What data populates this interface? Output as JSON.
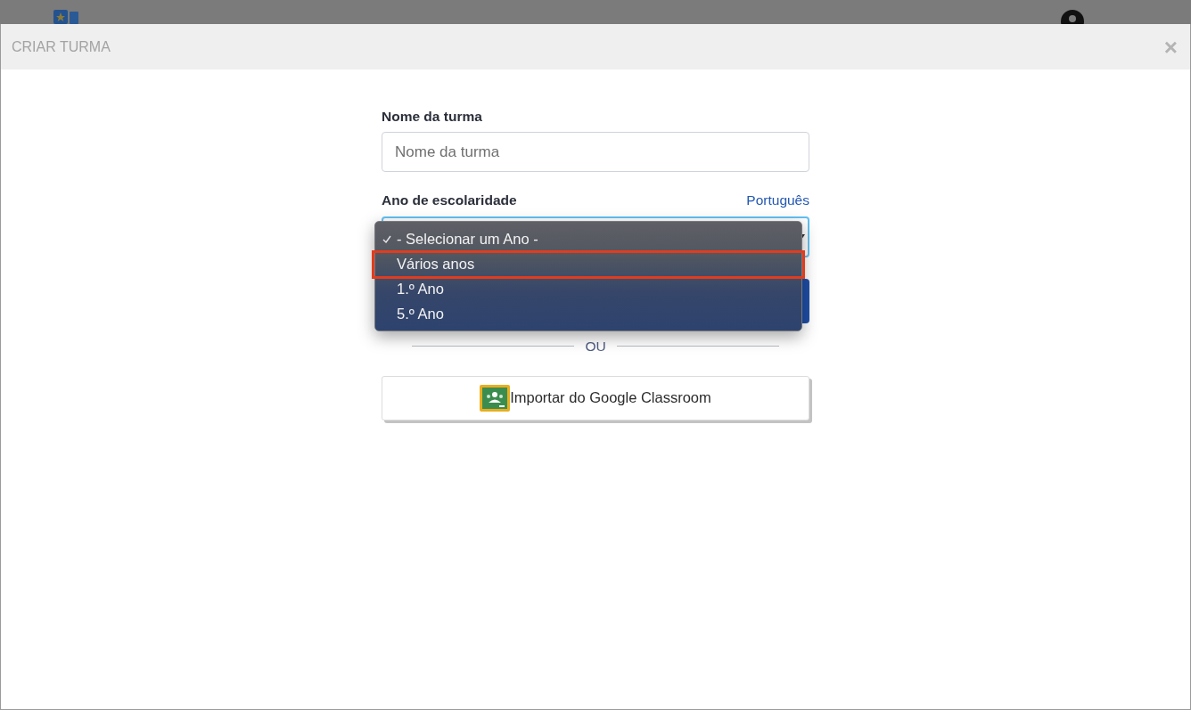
{
  "modal": {
    "title": "CRIAR TURMA",
    "close": "×"
  },
  "form": {
    "name_field": {
      "label": "Nome da turma",
      "placeholder": "Nome da turma"
    },
    "grade_field": {
      "label": "Ano de escolaridade",
      "language_link": "Português",
      "focused": true,
      "expanded": true
    },
    "grade_options": [
      {
        "label": "- Selecionar um Ano -",
        "selected": true,
        "highlighted": false
      },
      {
        "label": "Vários anos",
        "selected": false,
        "highlighted": true
      },
      {
        "label": "1.º Ano",
        "selected": false,
        "highlighted": false
      },
      {
        "label": "5.º Ano",
        "selected": false,
        "highlighted": false
      }
    ],
    "divider": "OU",
    "import_button": "Importar do Google Classroom"
  }
}
